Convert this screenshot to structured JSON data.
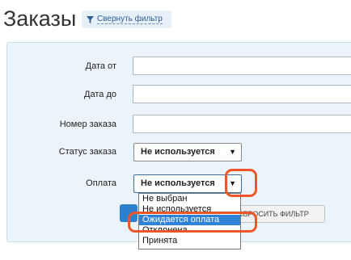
{
  "page": {
    "title": "Заказы",
    "collapse_filter_label": "Свернуть фильтр"
  },
  "filter": {
    "date_from_label": "Дата от",
    "date_to_label": "Дата до",
    "order_number_label": "Номер заказа",
    "order_status_label": "Статус заказа",
    "order_status_value": "Не используется",
    "payment_label": "Оплата",
    "payment_value": "Не используется",
    "reset_label": "СБРОСИТЬ ФИЛЬТР",
    "payment_options": [
      "Не выбран",
      "Не используется",
      "Ожидается оплата",
      "Отклонена",
      "Принята"
    ],
    "payment_highlighted_index": 2
  },
  "annotations": {
    "highlight_color": "#ee5628"
  }
}
